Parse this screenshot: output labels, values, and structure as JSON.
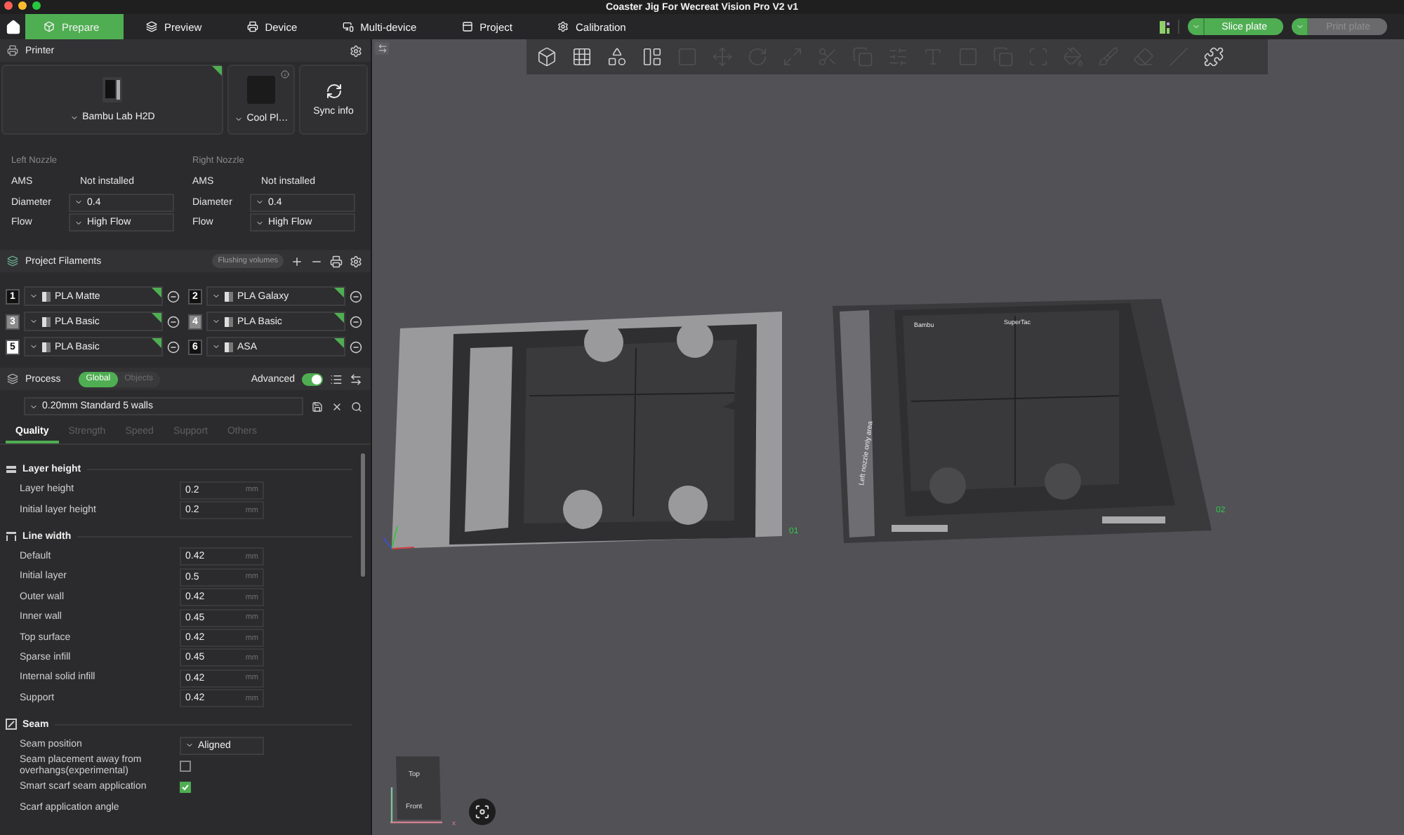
{
  "window": {
    "title": "Coaster Jig For Wecreat Vision Pro V2 v1"
  },
  "tabs": [
    {
      "label": "Prepare",
      "selected": true
    },
    {
      "label": "Preview",
      "selected": false
    },
    {
      "label": "Device",
      "selected": false
    },
    {
      "label": "Multi-device",
      "selected": false
    },
    {
      "label": "Project",
      "selected": false
    },
    {
      "label": "Calibration",
      "selected": false
    }
  ],
  "actions": {
    "slice": {
      "label": "Slice plate",
      "disabled": false
    },
    "print": {
      "label": "Print plate",
      "disabled": true
    }
  },
  "printer": {
    "title": "Printer",
    "model": "Bambu Lab H2D",
    "plate": "Cool Pl…",
    "sync": "Sync info"
  },
  "nozzles": [
    {
      "title": "Left Nozzle",
      "ams_label": "AMS",
      "ams": "Not installed",
      "diameter_label": "Diameter",
      "diameter": "0.4",
      "flow_label": "Flow",
      "flow": "High Flow"
    },
    {
      "title": "Right Nozzle",
      "ams_label": "AMS",
      "ams": "Not installed",
      "diameter_label": "Diameter",
      "diameter": "0.4",
      "flow_label": "Flow",
      "flow": "High Flow"
    }
  ],
  "filaments": {
    "title": "Project Filaments",
    "flushing": "Flushing volumes",
    "items": [
      {
        "index": "1",
        "name": "PLA Matte",
        "color": "#111111"
      },
      {
        "index": "2",
        "name": "PLA Galaxy",
        "color": "#111111"
      },
      {
        "index": "3",
        "name": "PLA Basic",
        "color": "#8a8a8a"
      },
      {
        "index": "4",
        "name": "PLA Basic",
        "color": "#8a8a8a"
      },
      {
        "index": "5",
        "name": "PLA Basic",
        "color": "#ffffff"
      },
      {
        "index": "6",
        "name": "ASA",
        "color": "#111111"
      }
    ]
  },
  "process": {
    "title": "Process",
    "modes": [
      {
        "label": "Global",
        "selected": true
      },
      {
        "label": "Objects",
        "selected": false
      }
    ],
    "advanced_label": "Advanced",
    "advanced": true,
    "preset": "0.20mm Standard 5 walls"
  },
  "process_tabs": [
    {
      "label": "Quality",
      "selected": true
    },
    {
      "label": "Strength",
      "selected": false
    },
    {
      "label": "Speed",
      "selected": false
    },
    {
      "label": "Support",
      "selected": false
    },
    {
      "label": "Others",
      "selected": false
    }
  ],
  "sections": [
    {
      "title": "Layer height",
      "rows": [
        {
          "kind": "number",
          "label": "Layer height",
          "value": "0.2",
          "unit": "mm"
        },
        {
          "kind": "number",
          "label": "Initial layer height",
          "value": "0.2",
          "unit": "mm"
        }
      ]
    },
    {
      "title": "Line width",
      "rows": [
        {
          "kind": "number",
          "label": "Default",
          "value": "0.42",
          "unit": "mm"
        },
        {
          "kind": "number",
          "label": "Initial layer",
          "value": "0.5",
          "unit": "mm"
        },
        {
          "kind": "number",
          "label": "Outer wall",
          "value": "0.42",
          "unit": "mm"
        },
        {
          "kind": "number",
          "label": "Inner wall",
          "value": "0.45",
          "unit": "mm"
        },
        {
          "kind": "number",
          "label": "Top surface",
          "value": "0.42",
          "unit": "mm"
        },
        {
          "kind": "number",
          "label": "Sparse infill",
          "value": "0.45",
          "unit": "mm"
        },
        {
          "kind": "number",
          "label": "Internal solid infill",
          "value": "0.42",
          "unit": "mm"
        },
        {
          "kind": "number",
          "label": "Support",
          "value": "0.42",
          "unit": "mm"
        }
      ]
    },
    {
      "title": "Seam",
      "rows": [
        {
          "kind": "select",
          "label": "Seam position",
          "value": "Aligned"
        },
        {
          "kind": "checkbox",
          "label": "Seam placement away from overhangs(experimental)",
          "checked": false
        },
        {
          "kind": "checkbox",
          "label": "Smart scarf seam application",
          "checked": true
        },
        {
          "kind": "label",
          "label": "Scarf application angle"
        }
      ]
    }
  ],
  "viewport_tools": [
    {
      "disabled": false
    },
    {
      "disabled": false
    },
    {
      "disabled": false
    },
    {
      "disabled": false
    },
    {
      "disabled": true
    },
    {
      "disabled": true
    },
    {
      "disabled": true
    },
    {
      "disabled": true
    },
    {
      "disabled": true
    },
    {
      "disabled": true
    },
    {
      "disabled": true
    },
    {
      "disabled": true
    },
    {
      "disabled": true
    },
    {
      "disabled": true
    },
    {
      "disabled": true
    },
    {
      "disabled": true
    },
    {
      "disabled": true
    },
    {
      "disabled": true
    },
    {
      "disabled": true
    },
    {
      "disabled": false
    }
  ],
  "plates": [
    {
      "number": "01"
    },
    {
      "number": "02",
      "area_label": "Left nozzle only area",
      "marks": [
        "Bambu",
        "SuperTac"
      ]
    }
  ],
  "nav_cube": {
    "top": "Top",
    "front": "Front",
    "axis": "x"
  }
}
